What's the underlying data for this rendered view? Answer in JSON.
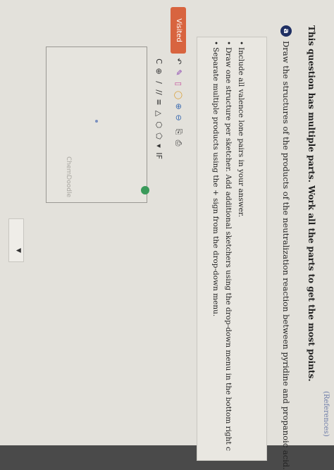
{
  "header": {
    "question_tag": "(References)"
  },
  "main_instruction": "This question has multiple parts. Work all the parts to get the most points.",
  "part": {
    "letter": "a",
    "question": "Draw the structures of the products of the neutralization reaction between pyridine and propanoic acid."
  },
  "instructions": [
    "Include all valence lone pairs in your answer.",
    "Draw one structure per sketcher. Add additional sketchers using the drop-down menu in the bottom right c",
    "Separate multiple products using the + sign from the drop-down menu."
  ],
  "visited_label": "Visited",
  "sketcher": {
    "watermark": "ChemDoodle",
    "top_tools": [
      "undo-icon",
      "pencil-icon",
      "eraser-icon",
      "lasso-icon",
      "zoom-in-icon",
      "zoom-out-icon",
      "copy-icon",
      "paste-icon"
    ],
    "bottom_tools": [
      "atom-c-icon",
      "charge-icon",
      "single-bond-icon",
      "double-bond-icon",
      "triple-bond-icon",
      "ring-cyclopropane-icon",
      "ring-benzene-icon",
      "ring-cyclohexane-icon",
      "dropdown-icon",
      "menu-icon"
    ],
    "bottom_tool_label": "IF"
  },
  "colors": {
    "visited": "#d8643f",
    "part_circle": "#1f2f63",
    "check": "#3a9a5a"
  }
}
